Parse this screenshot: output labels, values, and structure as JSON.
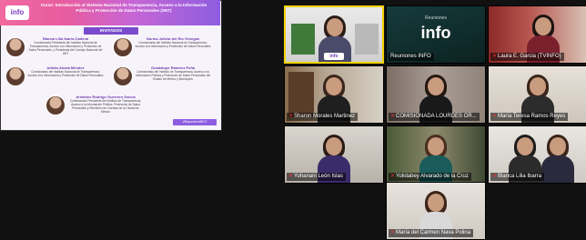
{
  "share": {
    "logo": "info",
    "title": "Curso: Introducción al Sistema Nacional de Transparencia, Acceso a la Información Pública y Protección de Datos Personales (SNT)",
    "invited_label": "INVITADOS",
    "guests": [
      {
        "name": "Blanca Lilia Ibarra Cadena",
        "desc": "Comisionada Presidenta del Instituto Nacional de Transparencia, Acceso a la Información y Protección de Datos Personales, y Presidenta del Consejo Nacional del SNT"
      },
      {
        "name": "Norma Julieta del Río Venegas",
        "desc": "Comisionada del Instituto Nacional de Transparencia, Acceso a la Información y Protección de Datos Personales"
      },
      {
        "name": "Adrián Alcalá Méndez",
        "desc": "Comisionado del Instituto Nacional de Transparencia, Acceso a la Información y Protección de Datos Personales"
      },
      {
        "name": "Guadalupe Ramírez Peña",
        "desc": "Comisionada del Instituto de Transparencia, Acceso a la Información Pública y Protección de Datos Personales del Estado de México y Municipios"
      },
      {
        "name": "Arístides Rodrigo Guerrero García",
        "desc": "Comisionado Presidente del Instituto de Transparencia, Acceso a la Información Pública, Protección de Datos Personales y Rendición de Cuentas de la Ciudad de México"
      }
    ],
    "hashtag": "#ReporteroINFO"
  },
  "tiles": [
    {
      "label": ""
    },
    {
      "label": "Reuniones INFO",
      "logo": "info",
      "logo_small": "Reuniones"
    },
    {
      "label": "Laura E. Garcia (TVINFO)"
    },
    {
      "label": "Sharon Morales Martinez"
    },
    {
      "label": "COMISIONADA LOURDES OR..."
    },
    {
      "label": "María Teresa Ramos Reyes"
    },
    {
      "label": "Yohanani León Islas"
    },
    {
      "label": "Yolidabey Alvarado de la Cruz"
    },
    {
      "label": "Blanca Lilia Ibarra"
    },
    {
      "label": "María del Carmen Nava Polina"
    }
  ]
}
